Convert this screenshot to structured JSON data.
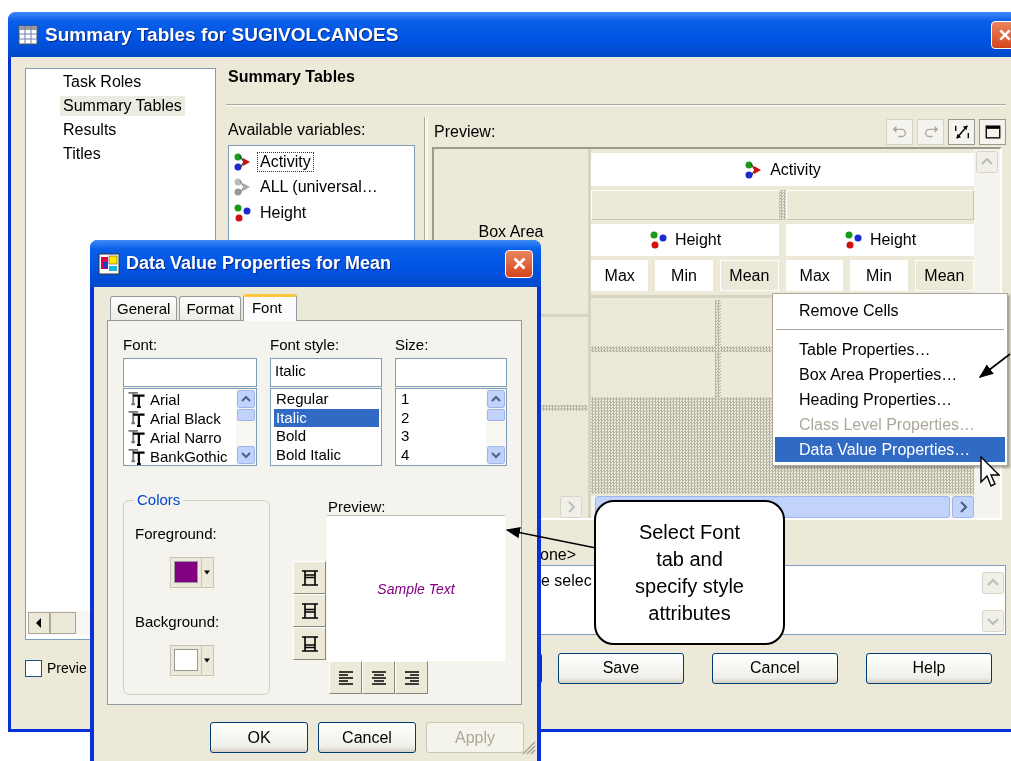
{
  "main_window": {
    "title": "Summary Tables for SUGIVOLCANOES",
    "nav": [
      {
        "label": "Task Roles",
        "selected": false
      },
      {
        "label": "Summary Tables",
        "selected": true
      },
      {
        "label": "Results",
        "selected": false
      },
      {
        "label": "Titles",
        "selected": false
      }
    ],
    "section_title": "Summary Tables",
    "variables": {
      "label": "Available variables:",
      "items": [
        {
          "name": "Activity",
          "kind": "category",
          "focused": true
        },
        {
          "name": "ALL (universal…",
          "kind": "universal",
          "focused": false
        },
        {
          "name": "Height",
          "kind": "analysis",
          "focused": false
        }
      ]
    },
    "preview": {
      "label": "Preview:",
      "toolbar": [
        {
          "kind": "undo",
          "disabled": true
        },
        {
          "kind": "redo",
          "disabled": true
        },
        {
          "kind": "swap",
          "disabled": false
        },
        {
          "kind": "maximize",
          "disabled": false
        }
      ],
      "box_area": "Box Area",
      "column_heading": {
        "name": "Activity",
        "kind": "category"
      },
      "subheadings": [
        {
          "name": "Height",
          "kind": "analysis",
          "stats": [
            {
              "label": "Max",
              "selected": false
            },
            {
              "label": "Min",
              "selected": false
            },
            {
              "label": "Mean",
              "selected": true
            }
          ]
        },
        {
          "name": "Height",
          "kind": "analysis",
          "stats": [
            {
              "label": "Max",
              "selected": false
            },
            {
              "label": "Min",
              "selected": false
            },
            {
              "label": "Mean",
              "selected": true
            }
          ]
        }
      ]
    },
    "box_area_value": "one>",
    "description": "e selec",
    "preview_checkbox": {
      "label": "Previe",
      "checked": false
    },
    "buttons": [
      "Save",
      "Cancel",
      "Help"
    ]
  },
  "context_menu": [
    {
      "label": "Remove Cells",
      "disabled": false,
      "selected": false,
      "separator_after": true
    },
    {
      "label": "Table Properties…",
      "disabled": false,
      "selected": false,
      "separator_after": false
    },
    {
      "label": "Box Area Properties…",
      "disabled": false,
      "selected": false,
      "separator_after": false
    },
    {
      "label": "Heading Properties…",
      "disabled": false,
      "selected": false,
      "separator_after": false
    },
    {
      "label": "Class Level Properties…",
      "disabled": true,
      "selected": false,
      "separator_after": false
    },
    {
      "label": "Data Value Properties…",
      "disabled": false,
      "selected": true,
      "separator_after": false
    }
  ],
  "dialog": {
    "title": "Data Value Properties for Mean",
    "tabs": [
      {
        "label": "General",
        "selected": false
      },
      {
        "label": "Format",
        "selected": false
      },
      {
        "label": "Font",
        "selected": true
      }
    ],
    "font": {
      "label": "Font:",
      "items": [
        {
          "label": "Arial",
          "selected": false
        },
        {
          "label": "Arial Black",
          "selected": false
        },
        {
          "label": "Arial Narro",
          "selected": false
        },
        {
          "label": "BankGothic",
          "selected": false
        }
      ]
    },
    "font_style": {
      "label": "Font style:",
      "value": "Italic",
      "items": [
        {
          "label": "Regular",
          "selected": false
        },
        {
          "label": "Italic",
          "selected": true
        },
        {
          "label": "Bold",
          "selected": false
        },
        {
          "label": "Bold Italic",
          "selected": false
        }
      ]
    },
    "size": {
      "label": "Size:",
      "items": [
        {
          "label": "1",
          "selected": false
        },
        {
          "label": "2",
          "selected": false
        },
        {
          "label": "3",
          "selected": false
        },
        {
          "label": "4",
          "selected": false
        }
      ]
    },
    "colors": {
      "label": "Colors",
      "items": [
        {
          "label": "Foreground:",
          "color": "#800080"
        },
        {
          "label": "Background:",
          "color": "#ffffff"
        }
      ]
    },
    "preview": {
      "label": "Preview:",
      "sample": "Sample Text"
    },
    "buttons": [
      {
        "label": "OK",
        "disabled": false
      },
      {
        "label": "Cancel",
        "disabled": false
      },
      {
        "label": "Apply",
        "disabled": true
      }
    ]
  },
  "callout": {
    "text": "Select Font tab and specify style attributes"
  }
}
